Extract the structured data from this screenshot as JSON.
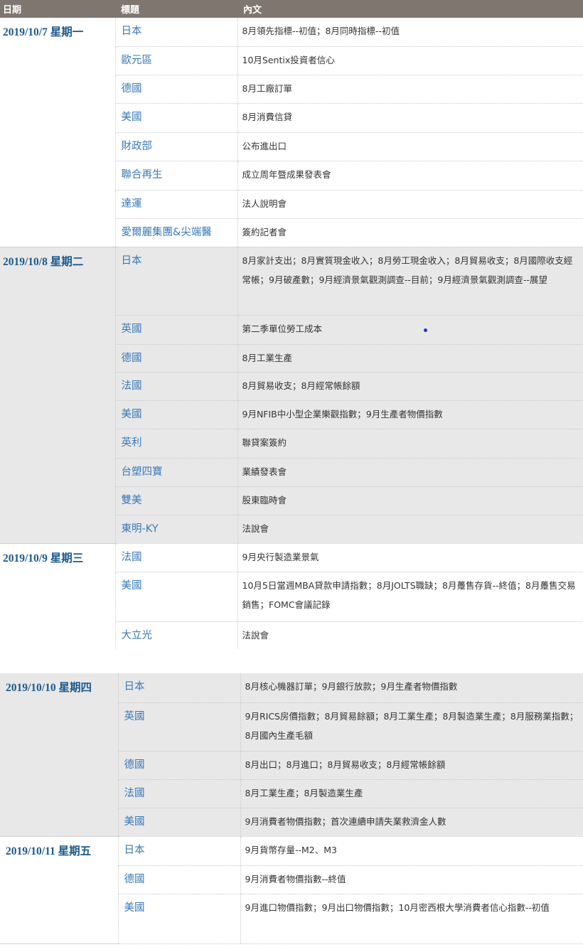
{
  "header": {
    "date": "日期",
    "title": "標題",
    "content": "內文"
  },
  "days": [
    {
      "date": "2019/10/7  星期一",
      "rows": [
        {
          "title": "日本",
          "content": "8月領先指標--初值；8月同時指標--初值"
        },
        {
          "title": "歐元區",
          "content": "10月Sentix投資者信心"
        },
        {
          "title": "德國",
          "content": "8月工廠訂單"
        },
        {
          "title": "美國",
          "content": "8月消費信貸"
        },
        {
          "title": "財政部",
          "content": "公布進出口"
        },
        {
          "title": "聯合再生",
          "content": "成立周年暨成果發表會"
        },
        {
          "title": "達運",
          "content": "法人說明會"
        },
        {
          "title": "愛爾麗集團&尖端醫",
          "content": "簽約記者會"
        }
      ]
    },
    {
      "date": "2019/10/8  星期二",
      "rows": [
        {
          "title": "日本",
          "content": "8月家計支出；8月實質現金收入；8月勞工現金收入；8月貿易收支；8月國際收支經常帳；9月破產數；9月經濟景氣觀測調查--目前；9月經濟景氣觀測調查--展望"
        },
        {
          "title": "英國",
          "content": "第二季單位勞工成本"
        },
        {
          "title": "德國",
          "content": "8月工業生產"
        },
        {
          "title": "法國",
          "content": "8月貿易收支；8月經常帳餘額"
        },
        {
          "title": "美國",
          "content": "9月NFIB中小型企業樂觀指數；9月生產者物價指數"
        },
        {
          "title": "英利",
          "content": "聯貸案簽約"
        },
        {
          "title": "台塑四寶",
          "content": "業績發表會"
        },
        {
          "title": "雙美",
          "content": "股東臨時會"
        },
        {
          "title": "東明-KY",
          "content": "法說會"
        }
      ]
    },
    {
      "date": "2019/10/9  星期三",
      "rows": [
        {
          "title": "法國",
          "content": "9月央行製造業景氣"
        },
        {
          "title": "美國",
          "content": "10月5日當週MBA貸款申請指數；8月JOLTS職缺；8月躉售存貨--終值；8月躉售交易銷售；FOMC會議記錄"
        },
        {
          "title": "大立光",
          "content": "法說會"
        }
      ]
    },
    {
      "date": "2019/10/10  星期四",
      "rows": [
        {
          "title": "日本",
          "content": "8月核心機器訂單；9月銀行放款；9月生產者物價指數"
        },
        {
          "title": "英國",
          "content": "9月RICS房價指數；8月貿易餘額；8月工業生產；8月製造業生產；8月服務業指數；8月國內生產毛額"
        },
        {
          "title": "德國",
          "content": "8月出口；8月進口；8月貿易收支；8月經常帳餘額"
        },
        {
          "title": "法國",
          "content": "8月工業生產；8月製造業生產"
        },
        {
          "title": "美國",
          "content": "9月消費者物價指數；首次連續申請失業救濟金人數"
        }
      ]
    },
    {
      "date": "2019/10/11  星期五",
      "rows": [
        {
          "title": "日本",
          "content": "9月貨幣存量--M2、M3"
        },
        {
          "title": "德國",
          "content": "9月消費者物價指數--終值"
        },
        {
          "title": "美國",
          "content": "9月進口物價指數；9月出口物價指數；10月密西根大學消費者信心指數--初值"
        }
      ]
    }
  ]
}
